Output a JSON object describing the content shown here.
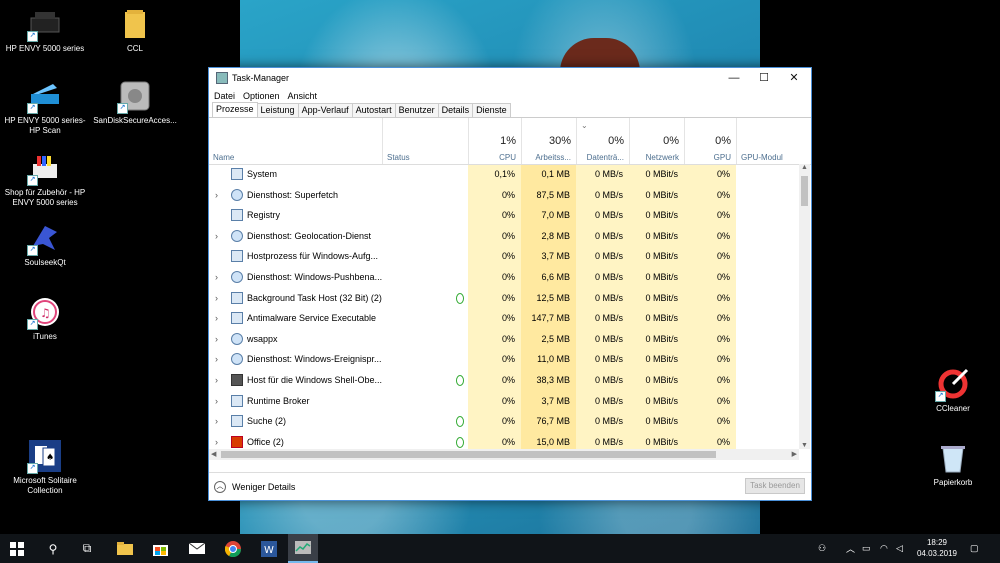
{
  "desktop": {
    "icons_left": [
      {
        "label": "HP ENVY 5000 series"
      },
      {
        "label": "HP ENVY 5000 series-HP Scan"
      },
      {
        "label": "Shop für Zubehör - HP ENVY 5000 series"
      },
      {
        "label": "SoulseekQt"
      },
      {
        "label": "iTunes"
      },
      {
        "label": "Microsoft Solitaire Collection"
      }
    ],
    "icons_mid": [
      {
        "label": "CCL"
      },
      {
        "label": "SanDiskSecureAcces..."
      }
    ],
    "icons_right": [
      {
        "label": "CCleaner"
      },
      {
        "label": "Papierkorb"
      }
    ]
  },
  "window": {
    "title": "Task-Manager",
    "menu": [
      "Datei",
      "Optionen",
      "Ansicht"
    ],
    "tabs": [
      "Prozesse",
      "Leistung",
      "App-Verlauf",
      "Autostart",
      "Benutzer",
      "Details",
      "Dienste"
    ],
    "columns": {
      "name": "Name",
      "status": "Status",
      "cpu": {
        "pct": "1%",
        "label": "CPU"
      },
      "mem": {
        "pct": "30%",
        "label": "Arbeitss..."
      },
      "disk": {
        "pct": "0%",
        "label": "Datenträ..."
      },
      "net": {
        "pct": "0%",
        "label": "Netzwerk"
      },
      "gpu": {
        "pct": "0%",
        "label": "GPU"
      },
      "gpu_engine": {
        "label": "GPU-Modul"
      }
    },
    "rows": [
      {
        "name": "System",
        "cpu": "0,1%",
        "mem": "0,1 MB",
        "disk": "0 MB/s",
        "net": "0 MBit/s",
        "gpu": "0%"
      },
      {
        "name": "Diensthost: Superfetch",
        "cpu": "0%",
        "mem": "87,5 MB",
        "disk": "0 MB/s",
        "net": "0 MBit/s",
        "gpu": "0%"
      },
      {
        "name": "Registry",
        "cpu": "0%",
        "mem": "7,0 MB",
        "disk": "0 MB/s",
        "net": "0 MBit/s",
        "gpu": "0%"
      },
      {
        "name": "Diensthost: Geolocation-Dienst",
        "cpu": "0%",
        "mem": "2,8 MB",
        "disk": "0 MB/s",
        "net": "0 MBit/s",
        "gpu": "0%"
      },
      {
        "name": "Hostprozess für Windows-Aufg...",
        "cpu": "0%",
        "mem": "3,7 MB",
        "disk": "0 MB/s",
        "net": "0 MBit/s",
        "gpu": "0%"
      },
      {
        "name": "Diensthost: Windows-Pushbena...",
        "cpu": "0%",
        "mem": "6,6 MB",
        "disk": "0 MB/s",
        "net": "0 MBit/s",
        "gpu": "0%"
      },
      {
        "name": "Background Task Host (32 Bit) (2)",
        "cpu": "0%",
        "mem": "12,5 MB",
        "disk": "0 MB/s",
        "net": "0 MBit/s",
        "gpu": "0%"
      },
      {
        "name": "Antimalware Service Executable",
        "cpu": "0%",
        "mem": "147,7 MB",
        "disk": "0 MB/s",
        "net": "0 MBit/s",
        "gpu": "0%"
      },
      {
        "name": "wsappx",
        "cpu": "0%",
        "mem": "2,5 MB",
        "disk": "0 MB/s",
        "net": "0 MBit/s",
        "gpu": "0%"
      },
      {
        "name": "Diensthost: Windows-Ereignispr...",
        "cpu": "0%",
        "mem": "11,0 MB",
        "disk": "0 MB/s",
        "net": "0 MBit/s",
        "gpu": "0%"
      },
      {
        "name": "Host für die Windows Shell-Obe...",
        "cpu": "0%",
        "mem": "38,3 MB",
        "disk": "0 MB/s",
        "net": "0 MBit/s",
        "gpu": "0%"
      },
      {
        "name": "Runtime Broker",
        "cpu": "0%",
        "mem": "3,7 MB",
        "disk": "0 MB/s",
        "net": "0 MBit/s",
        "gpu": "0%"
      },
      {
        "name": "Suche (2)",
        "cpu": "0%",
        "mem": "76,7 MB",
        "disk": "0 MB/s",
        "net": "0 MBit/s",
        "gpu": "0%"
      },
      {
        "name": "Office (2)",
        "cpu": "0%",
        "mem": "15,0 MB",
        "disk": "0 MB/s",
        "net": "0 MBit/s",
        "gpu": "0%"
      }
    ],
    "fewer_details": "Weniger Details",
    "end_task": "Task beenden"
  },
  "taskbar": {
    "time": "18:29",
    "date": "04.03.2019"
  },
  "colors": {
    "heat_light": "#fff4c4",
    "heat_mid": "#ffe9a0",
    "accent": "#0078d7"
  }
}
